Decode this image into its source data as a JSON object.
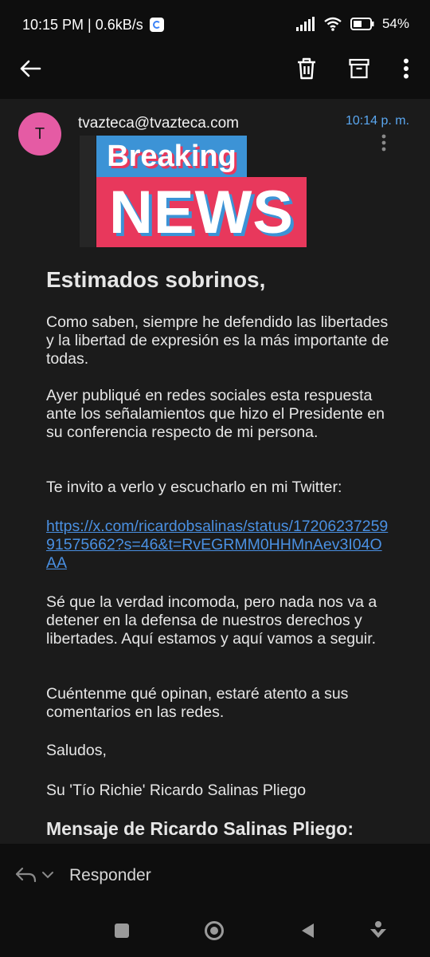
{
  "status_bar": {
    "time": "10:15 PM | 0.6kB/s",
    "battery": "54%"
  },
  "toolbar": {
    "back_icon": "arrow-left-icon",
    "delete_icon": "trash-icon",
    "archive_icon": "archive-icon",
    "more_icon": "more-vertical-icon"
  },
  "message": {
    "avatar_initial": "T",
    "avatar_color": "#e55ba4",
    "sender": "tvazteca@tvazteca.com",
    "time": "10:14 p. m.",
    "banner": {
      "top_word": "Breaking",
      "bottom_word": "NEWS"
    },
    "greeting": "Estimados sobrinos,",
    "paragraphs": [
      "Como saben, siempre he defendido las libertades y la libertad de expresión es la más importante de todas.",
      "Ayer publiqué en redes sociales esta respuesta ante los señalamientos que hizo el Presidente en su conferencia respecto de mi persona.",
      "Te invito a verlo y escucharlo en mi Twitter:",
      "Sé que la verdad incomoda, pero nada nos va a detener en la defensa de nuestros derechos y libertades. Aquí estamos y aquí vamos a seguir.",
      "Cuéntenme qué opinan, estaré atento a sus comentarios en las redes.",
      "Saludos,",
      "Su 'Tío Richie' Ricardo Salinas Pliego"
    ],
    "link": "https://x.com/ricardobsalinas/status/1720623725991575662?s=46&t=RvEGRMM0HHMnAev3I04OAA",
    "signature_heading": "Mensaje de Ricardo Salinas Pliego:"
  },
  "reply_bar": {
    "label": "Responder"
  },
  "colors": {
    "accent_link": "#4a90e2",
    "timestamp": "#5aa7f0",
    "banner_blue": "#3c93d6",
    "banner_red": "#e8385c"
  }
}
